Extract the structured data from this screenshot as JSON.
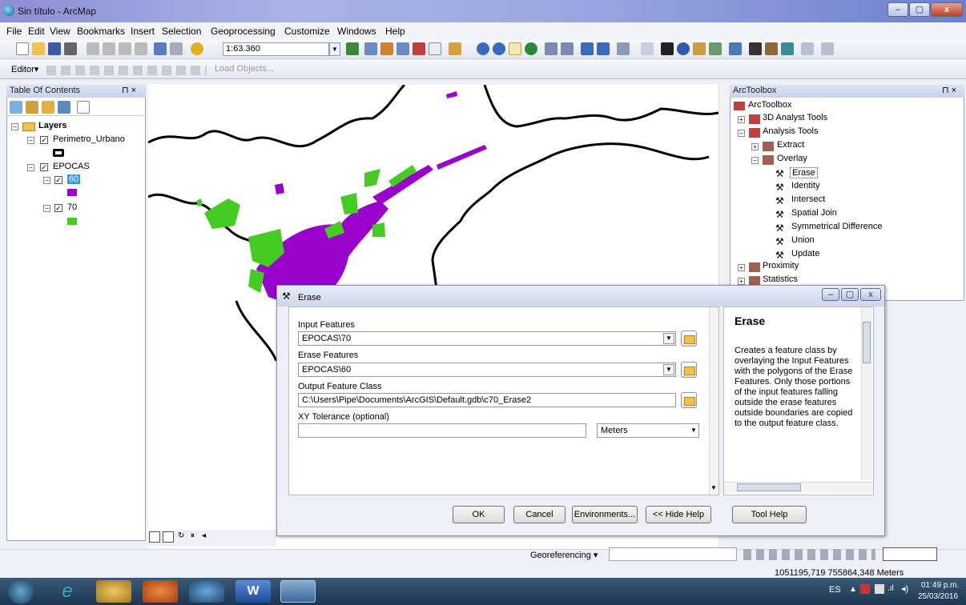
{
  "window": {
    "title": "Sin título - ArcMap",
    "min": "–",
    "max": "▢",
    "close": "x"
  },
  "menu": [
    "File",
    "Edit",
    "View",
    "Bookmarks",
    "Insert",
    "Selection",
    "Geoprocessing",
    "Customize",
    "Windows",
    "Help"
  ],
  "toolbar": {
    "scale": "1:63.360",
    "editor": "Editor▾",
    "load_objects": "Load Objects..."
  },
  "toc": {
    "title": "Table Of Contents",
    "pin": "⊓ ×",
    "layers_root": "Layers",
    "items": [
      {
        "label": "Perimetro_Urbano"
      },
      {
        "label": "EPOCAS"
      },
      {
        "label": "60",
        "color": "#9900cc"
      },
      {
        "label": "70",
        "color": "#44cc22"
      }
    ]
  },
  "toolbox": {
    "title": "ArcToolbox",
    "pin": "⊓ ×",
    "root": "ArcToolbox",
    "items": [
      "3D Analyst Tools",
      "Analysis Tools",
      "Extract",
      "Overlay",
      "Erase",
      "Identity",
      "Intersect",
      "Spatial Join",
      "Symmetrical Difference",
      "Union",
      "Update",
      "Proximity",
      "Statistics"
    ]
  },
  "dialog": {
    "title": "Erase",
    "input_label": "Input Features",
    "input_value": "EPOCAS\\70",
    "erase_label": "Erase Features",
    "erase_value": "EPOCAS\\60",
    "output_label": "Output Feature Class",
    "output_value": "C:\\Users\\Pipe\\Documents\\ArcGIS\\Default.gdb\\c70_Erase2",
    "xy_label": "XY Tolerance (optional)",
    "xy_value": "",
    "units": "Meters",
    "help_title": "Erase",
    "help_text": "Creates a feature class by overlaying the Input Features with the polygons of the Erase Features. Only those portions of the input features falling outside the erase features outside boundaries are copied to the output feature class.",
    "buttons": {
      "ok": "OK",
      "cancel": "Cancel",
      "environments": "Environments...",
      "hide_help": "<< Hide Help",
      "tool_help": "Tool Help"
    }
  },
  "status": {
    "georef": "Georeferencing ▾",
    "coords": "1051195,719  755864,348 Meters"
  },
  "taskbar": {
    "lang": "ES",
    "time": "01:49 p.m.",
    "date": "25/03/2016"
  }
}
